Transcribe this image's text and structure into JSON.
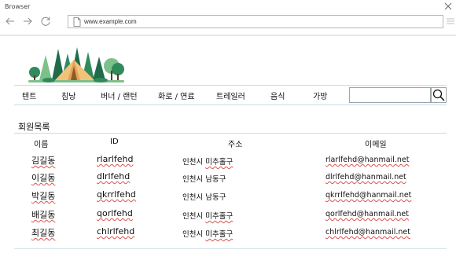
{
  "browser": {
    "title": "Browser",
    "url": "www.example.com"
  },
  "nav": {
    "items": [
      {
        "label": "텐트",
        "key": "tent"
      },
      {
        "label": "침낭",
        "key": "sleeping-bag"
      },
      {
        "label": "버너 / 랜턴",
        "key": "burner-lantern"
      },
      {
        "label": "화로 / 연료",
        "key": "brazier-fuel"
      },
      {
        "label": "트레일러",
        "key": "trailer"
      },
      {
        "label": "음식",
        "key": "food"
      },
      {
        "label": "가방",
        "key": "bag"
      }
    ],
    "search_placeholder": ""
  },
  "members": {
    "title": "회원목록",
    "headers": {
      "name": "이름",
      "id": "ID",
      "address": "주소",
      "email": "이메일"
    },
    "rows": [
      {
        "name": "김길동",
        "id": "rlarlfehd",
        "addr_city": "인천시",
        "addr_district": "미추홀구",
        "email": "rlarlfehd@hanmail.net"
      },
      {
        "name": "이길동",
        "id": "dlrlfehd",
        "addr_city": "인천시",
        "addr_district": "남동구",
        "email": "dlrlfehd@hanmail.net"
      },
      {
        "name": "박길동",
        "id": "qkrrlfehd",
        "addr_city": "인천시",
        "addr_district": "남동구",
        "email": "qkrrlfehd@hanmail.net"
      },
      {
        "name": "배길동",
        "id": "qorlfehd",
        "addr_city": "인천시",
        "addr_district": "미추홀구",
        "email": "qorlfehd@hanmail.net"
      },
      {
        "name": "최길동",
        "id": "chlrlfehd",
        "addr_city": "인천시",
        "addr_district": "미추홀구",
        "email": "chlrlfehd@hanmail.net"
      }
    ]
  },
  "colors": {
    "tent": "#f2c27a",
    "tree_dark": "#1f6b4a",
    "tree_light": "#7cc08a",
    "divider": "#c8dde3",
    "spell_squiggle": "#d9534f"
  }
}
